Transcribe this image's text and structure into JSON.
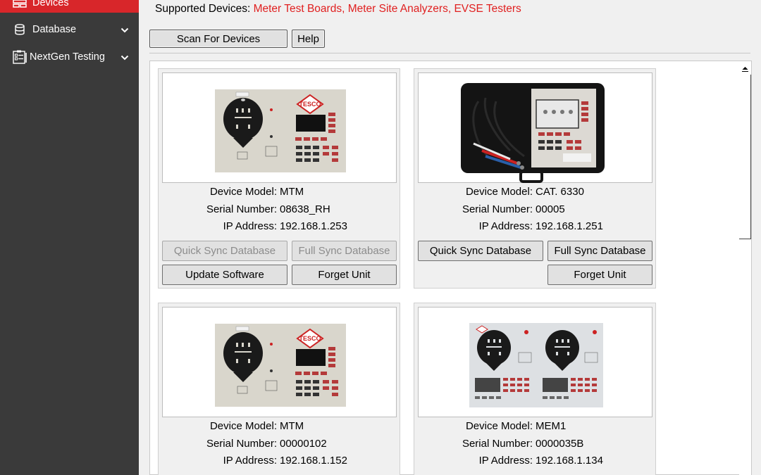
{
  "sidebar": {
    "items": [
      {
        "label": "Devices"
      },
      {
        "label": "Database"
      },
      {
        "label": "NextGen Testing"
      }
    ]
  },
  "header": {
    "supported_label": "Supported Devices:",
    "supported_value": "Meter Test Boards, Meter Site Analyzers, EVSE Testers",
    "scan_button": "Scan For Devices",
    "help_button": "Help"
  },
  "labels": {
    "model": "Device Model:",
    "serial": "Serial Number:",
    "ip": "IP Address:"
  },
  "devices": [
    {
      "model": "MTM",
      "serial": "08638_RH",
      "ip": "192.168.1.253",
      "quick_sync": "Quick Sync Database",
      "full_sync": "Full Sync Database",
      "update": "Update Software",
      "forget": "Forget Unit"
    },
    {
      "model": "CAT. 6330",
      "serial": "00005",
      "ip": "192.168.1.251",
      "quick_sync": "Quick Sync Database",
      "full_sync": "Full Sync Database",
      "forget": "Forget Unit"
    },
    {
      "model": "MTM",
      "serial": "00000102",
      "ip": "192.168.1.152"
    },
    {
      "model": "MEM1",
      "serial": "0000035B",
      "ip": "192.168.1.134"
    }
  ],
  "colors": {
    "sidebar_bg": "#3a3a3a",
    "accent_red": "#d8262a",
    "supported_red": "#e02020"
  }
}
